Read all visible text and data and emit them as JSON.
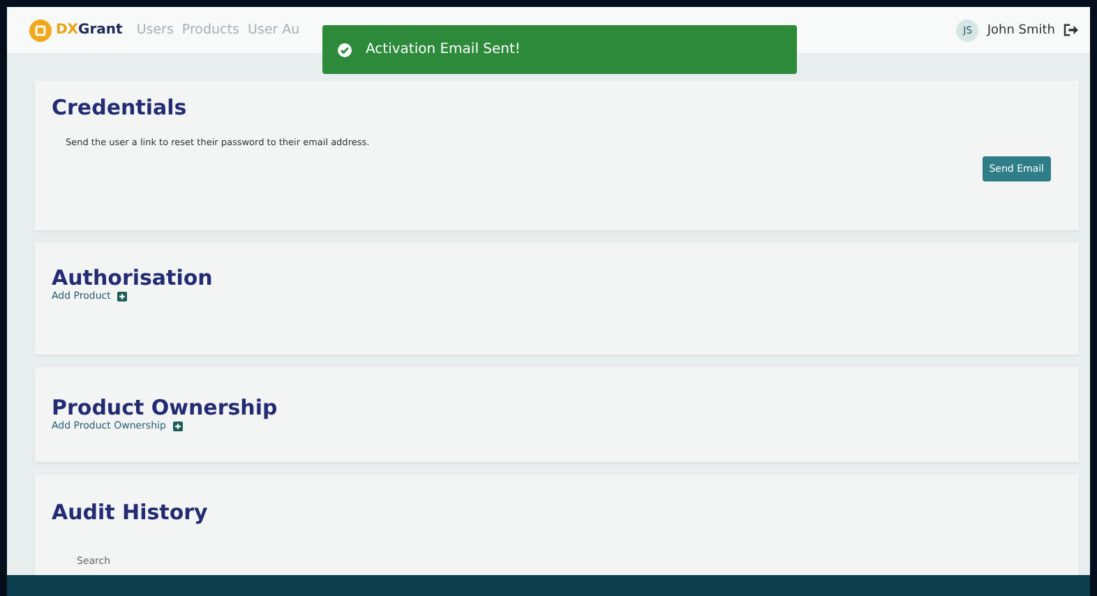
{
  "navbar": {
    "brand_prefix": "DX",
    "brand_suffix": "Grant",
    "links": [
      "Users",
      "Products",
      "User Au"
    ],
    "user": {
      "initials": "JS",
      "name": "John Smith"
    }
  },
  "toast": {
    "message": "Activation Email Sent!"
  },
  "sections": [
    {
      "title": "Credentials",
      "description": "Send the user a link to reset their password to their email address.",
      "button": "Send Email"
    },
    {
      "title": "Authorisation",
      "add_link": "Add Product"
    },
    {
      "title": "Product Ownership",
      "add_link": "Add Product Ownership"
    },
    {
      "title": "Audit History",
      "search_label": "Search"
    }
  ]
}
